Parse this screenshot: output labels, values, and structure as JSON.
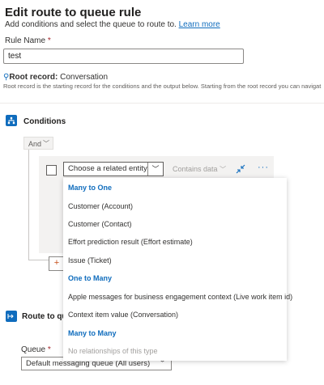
{
  "header": {
    "title": "Edit route to queue rule",
    "subtitle": "Add conditions and select the queue to route to.",
    "learn_more": "Learn more"
  },
  "rule_name": {
    "label": "Rule Name",
    "required_mark": "*",
    "value": "test"
  },
  "root_record": {
    "label": "Root record:",
    "value": "Conversation",
    "description": "Root record is the starting record for the conditions and the output below. Starting from the root record you can navigat"
  },
  "conditions": {
    "title": "Conditions",
    "operator": "And",
    "entity_placeholder": "Choose a related entity",
    "contains_data": "Contains data",
    "add_symbol": "+"
  },
  "dropdown": {
    "many_to_one_header": "Many to One",
    "many_to_one": [
      "Customer (Account)",
      "Customer (Contact)",
      "Effort prediction result (Effort estimate)",
      "Issue (Ticket)"
    ],
    "one_to_many_header": "One to Many",
    "one_to_many": [
      "Apple messages for business engagement context (Live work item id)",
      "Context item value (Conversation)"
    ],
    "many_to_many_header": "Many to Many",
    "many_to_many_empty": "No relationships of this type"
  },
  "route": {
    "title": "Route to que",
    "queue_label": "Queue",
    "required_mark": "*",
    "queue_value": "Default messaging queue (All users)"
  },
  "colors": {
    "accent": "#0f6cbd",
    "required": "#a4262c",
    "panel": "#f3f2f1"
  }
}
